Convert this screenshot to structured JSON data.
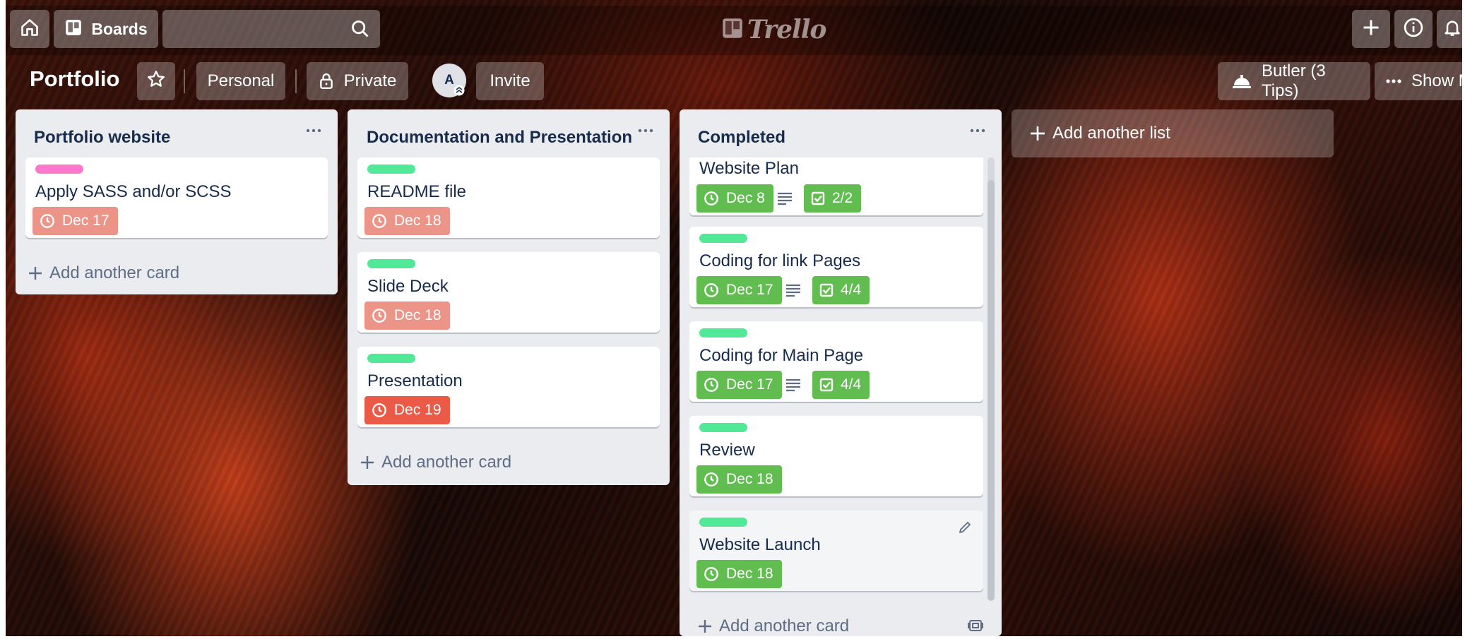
{
  "header": {
    "boards_label": "Boards",
    "logo_text": "Trello"
  },
  "board": {
    "title": "Portfolio",
    "visibility_team": "Personal",
    "visibility_private": "Private",
    "member_initial": "A",
    "invite_label": "Invite",
    "butler_label": "Butler (3 Tips)",
    "show_menu_label": "Show M"
  },
  "lists": [
    {
      "title": "Portfolio website",
      "cards": [
        {
          "label_color": "#ff78cb",
          "title": "Apply SASS and/or SCSS",
          "due": "Dec 17",
          "due_color": "#ec9488"
        }
      ],
      "add_card": "Add another card"
    },
    {
      "title": "Documentation and Presentation",
      "cards": [
        {
          "label_color": "#51e898",
          "title": "README file",
          "due": "Dec 18",
          "due_color": "#ec9488"
        },
        {
          "label_color": "#51e898",
          "title": "Slide Deck",
          "due": "Dec 18",
          "due_color": "#ec9488"
        },
        {
          "label_color": "#51e898",
          "title": "Presentation",
          "due": "Dec 19",
          "due_color": "#eb5a46"
        }
      ],
      "add_card": "Add another card"
    },
    {
      "title": "Completed",
      "cards": [
        {
          "title": "Website Plan",
          "due": "Dec 8",
          "checklist": "2/2",
          "due_color": "#61bd4f"
        },
        {
          "label_color": "#51e898",
          "title": "Coding for link Pages",
          "due": "Dec 17",
          "checklist": "4/4",
          "due_color": "#61bd4f"
        },
        {
          "label_color": "#51e898",
          "title": "Coding for Main Page",
          "due": "Dec 17",
          "checklist": "4/4",
          "due_color": "#61bd4f"
        },
        {
          "label_color": "#51e898",
          "title": "Review",
          "due": "Dec 18",
          "due_color": "#61bd4f"
        },
        {
          "label_color": "#51e898",
          "title": "Website Launch",
          "due": "Dec 18",
          "due_color": "#61bd4f"
        }
      ],
      "add_card": "Add another card"
    }
  ],
  "add_list": "Add another list",
  "icons": [
    "home-icon",
    "boards-icon",
    "search-icon",
    "plus-icon",
    "info-icon",
    "bell-icon",
    "star-icon",
    "lock-icon",
    "butler-icon",
    "ellipsis-icon",
    "clock-icon",
    "description-icon",
    "checklist-icon",
    "pencil-icon",
    "template-icon"
  ]
}
